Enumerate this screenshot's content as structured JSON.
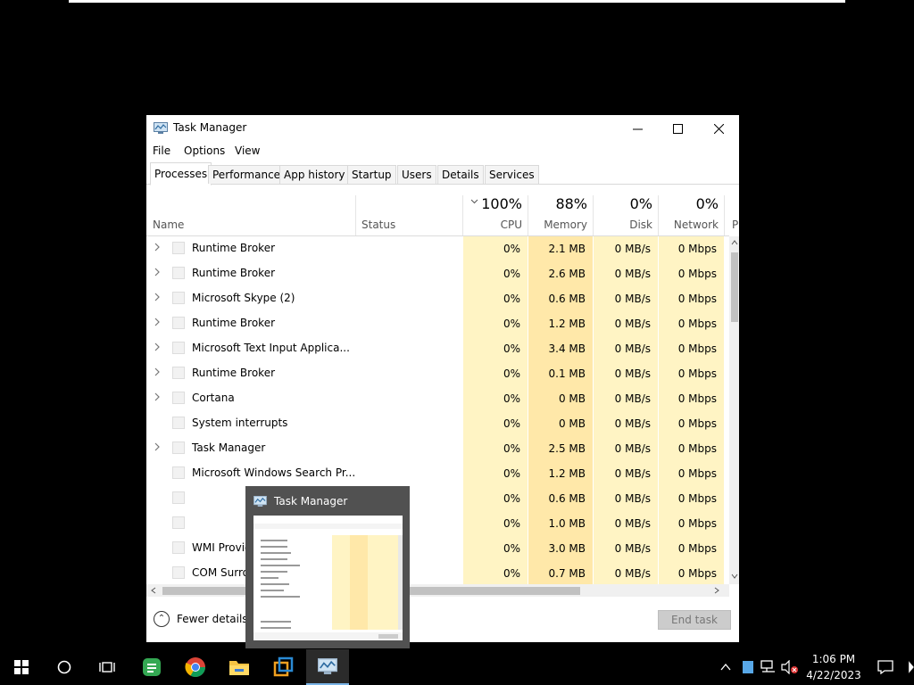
{
  "window": {
    "title": "Task Manager",
    "controls": {
      "minimize": "—",
      "maximize": "☐",
      "close": "✕"
    }
  },
  "menu": [
    "File",
    "Options",
    "View"
  ],
  "tabs": [
    "Processes",
    "Performance",
    "App history",
    "Startup",
    "Users",
    "Details",
    "Services"
  ],
  "columns": {
    "name": "Name",
    "status": "Status",
    "cpu": {
      "pct": "100%",
      "label": "CPU"
    },
    "memory": {
      "pct": "88%",
      "label": "Memory"
    },
    "disk": {
      "pct": "0%",
      "label": "Disk"
    },
    "network": {
      "pct": "0%",
      "label": "Network"
    },
    "power": "P"
  },
  "processes": [
    {
      "name": "Runtime Broker",
      "expand": true,
      "cpu": "0%",
      "memory": "2.1 MB",
      "disk": "0 MB/s",
      "network": "0 Mbps"
    },
    {
      "name": "Runtime Broker",
      "expand": true,
      "cpu": "0%",
      "memory": "2.6 MB",
      "disk": "0 MB/s",
      "network": "0 Mbps"
    },
    {
      "name": "Microsoft Skype (2)",
      "expand": true,
      "cpu": "0%",
      "memory": "0.6 MB",
      "disk": "0 MB/s",
      "network": "0 Mbps"
    },
    {
      "name": "Runtime Broker",
      "expand": true,
      "cpu": "0%",
      "memory": "1.2 MB",
      "disk": "0 MB/s",
      "network": "0 Mbps"
    },
    {
      "name": "Microsoft Text Input Applica...",
      "expand": true,
      "cpu": "0%",
      "memory": "3.4 MB",
      "disk": "0 MB/s",
      "network": "0 Mbps"
    },
    {
      "name": "Runtime Broker",
      "expand": true,
      "cpu": "0%",
      "memory": "0.1 MB",
      "disk": "0 MB/s",
      "network": "0 Mbps"
    },
    {
      "name": "Cortana",
      "expand": true,
      "cpu": "0%",
      "memory": "0 MB",
      "disk": "0 MB/s",
      "network": "0 Mbps"
    },
    {
      "name": "System interrupts",
      "expand": false,
      "cpu": "0%",
      "memory": "0 MB",
      "disk": "0 MB/s",
      "network": "0 Mbps"
    },
    {
      "name": "Task Manager",
      "expand": true,
      "cpu": "0%",
      "memory": "2.5 MB",
      "disk": "0 MB/s",
      "network": "0 Mbps"
    },
    {
      "name": "Microsoft Windows Search Pr...",
      "expand": false,
      "cpu": "0%",
      "memory": "1.2 MB",
      "disk": "0 MB/s",
      "network": "0 Mbps"
    },
    {
      "name": "",
      "expand": false,
      "cpu": "0%",
      "memory": "0.6 MB",
      "disk": "0 MB/s",
      "network": "0 Mbps"
    },
    {
      "name": "",
      "expand": false,
      "cpu": "0%",
      "memory": "1.0 MB",
      "disk": "0 MB/s",
      "network": "0 Mbps"
    },
    {
      "name": "WMI Provider Host",
      "expand": false,
      "cpu": "0%",
      "memory": "3.0 MB",
      "disk": "0 MB/s",
      "network": "0 Mbps"
    },
    {
      "name": "COM Surrogate",
      "expand": false,
      "cpu": "0%",
      "memory": "0.7 MB",
      "disk": "0 MB/s",
      "network": "0 Mbps"
    }
  ],
  "footer": {
    "fewer_details": "Fewer details",
    "end_task": "End task"
  },
  "thumbnail": {
    "title": "Task Manager"
  },
  "tray": {
    "time": "1:06 PM",
    "date": "4/22/2023"
  },
  "colors": {
    "cpu_bg": "#fff4c4",
    "memory_bg": "#ffe8a9",
    "taskbar_bg": "#000000"
  }
}
